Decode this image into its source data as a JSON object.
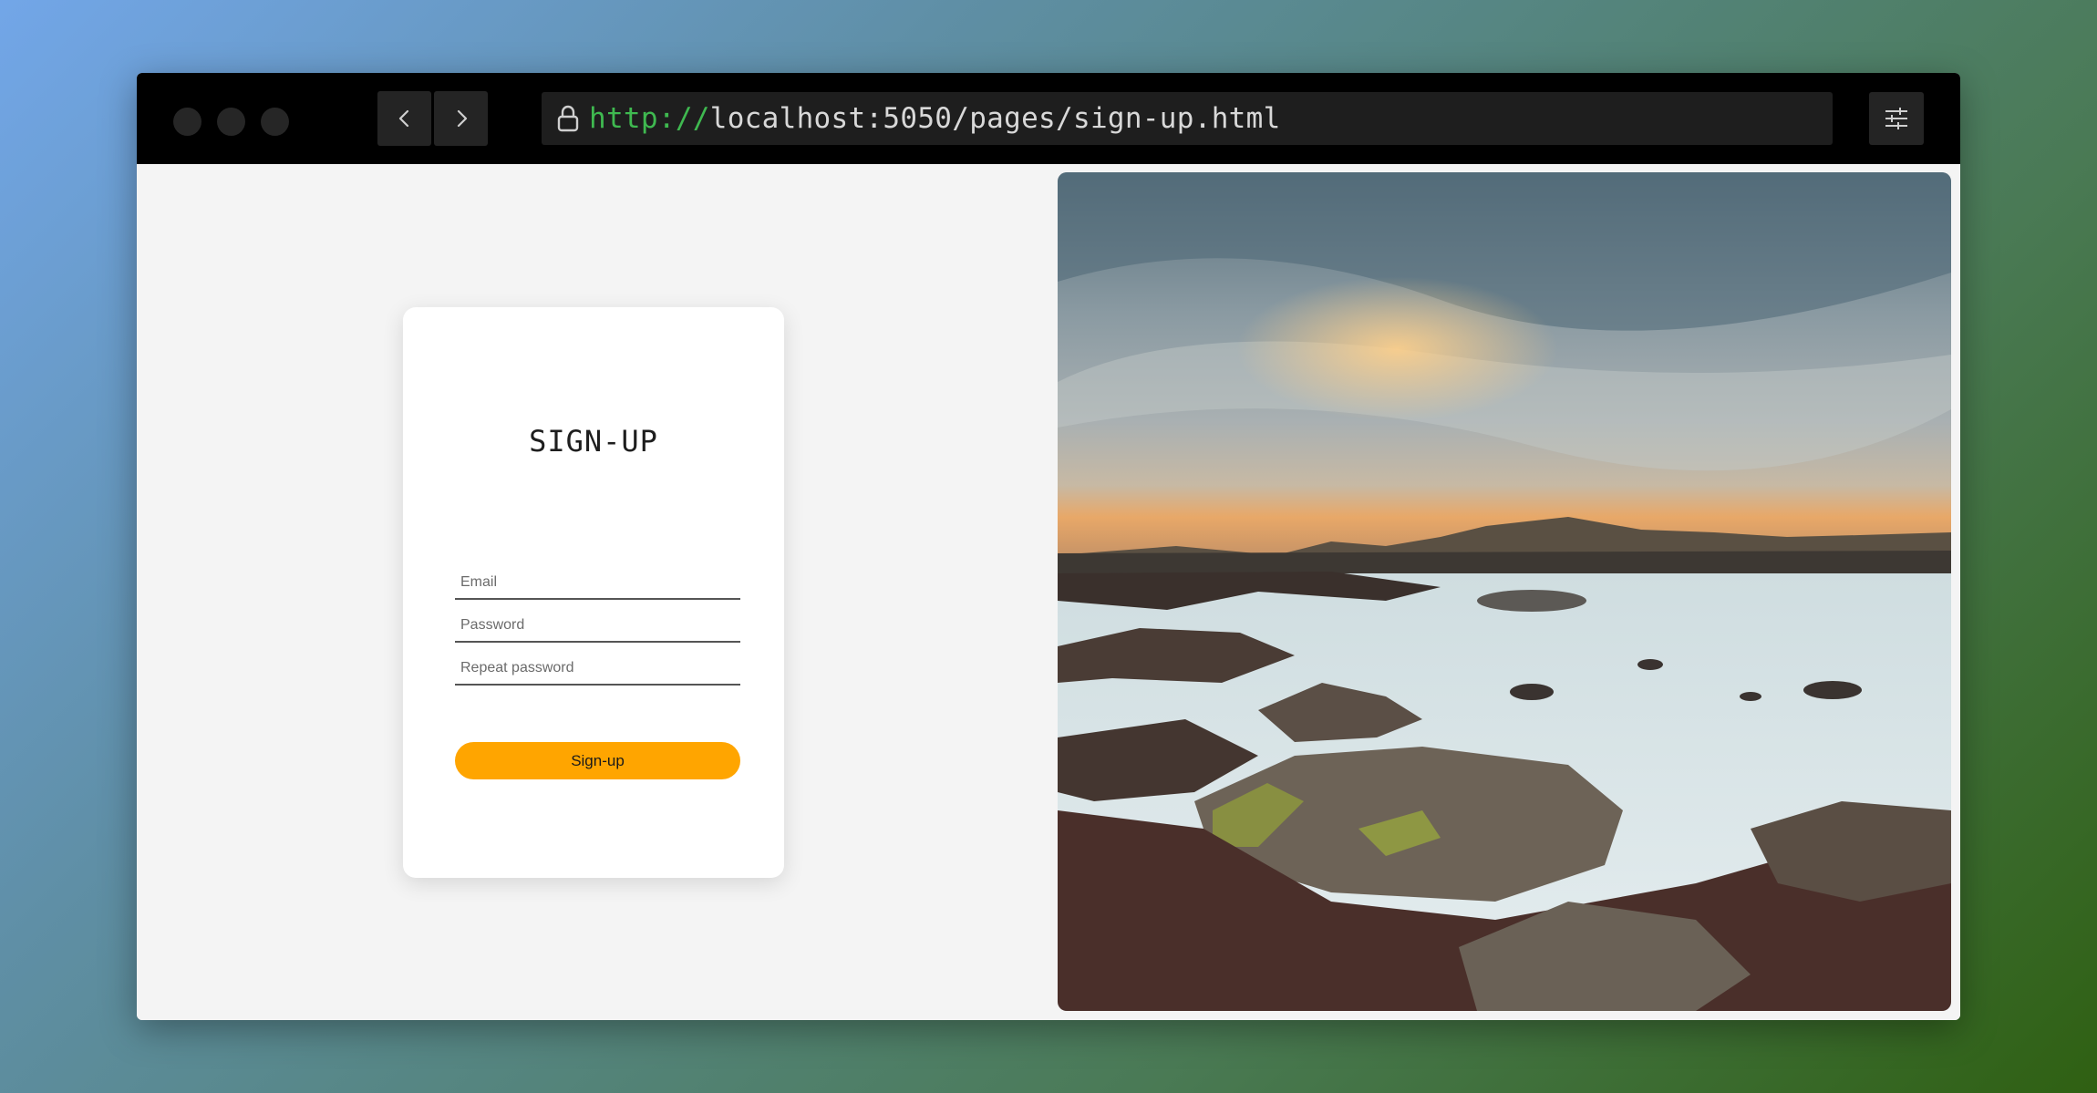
{
  "browser": {
    "url_protocol": "http://",
    "url_rest": "localhost:5050/pages/sign-up.html",
    "back_icon": "chevron-left-icon",
    "forward_icon": "chevron-right-icon",
    "lock_icon": "lock-icon",
    "settings_icon": "sliders-icon"
  },
  "form": {
    "title": "SIGN-UP",
    "email_placeholder": "Email",
    "password_placeholder": "Password",
    "repeat_password_placeholder": "Repeat password",
    "submit_label": "Sign-up"
  },
  "colors": {
    "accent": "#ffa500",
    "protocol": "#3fb950"
  }
}
